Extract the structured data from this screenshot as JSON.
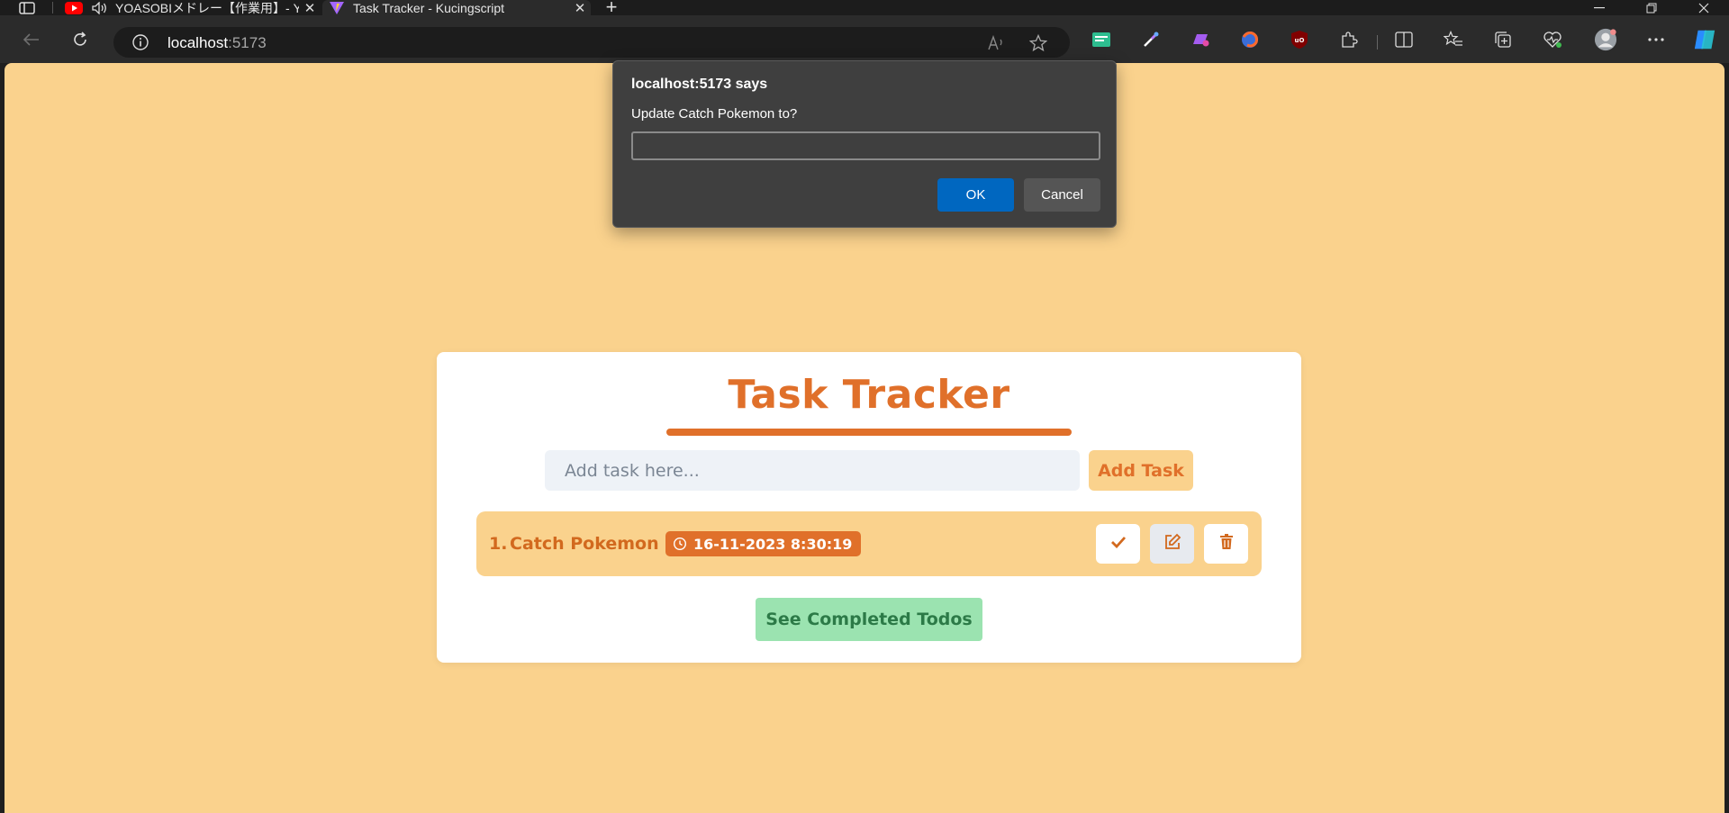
{
  "browser": {
    "tabs": [
      {
        "label": "YOASOBIメドレー【作業用】- YouTube",
        "favicon": "youtube-icon",
        "audio": "speaker-icon"
      },
      {
        "label": "Task Tracker - Kucingscript",
        "favicon": "vite-icon",
        "active": true
      }
    ],
    "address": {
      "host": "localhost",
      "port": ":5173"
    }
  },
  "app": {
    "title": "Task Tracker",
    "input": {
      "placeholder": "Add task here...",
      "value": ""
    },
    "add_button": "Add Task",
    "tasks": [
      {
        "number": "1.",
        "text": "Catch Pokemon",
        "timestamp": "16-11-2023 8:30:19"
      }
    ],
    "completed_button": "See Completed Todos"
  },
  "dialog": {
    "title": "localhost:5173 says",
    "message": "Update Catch Pokemon to?",
    "value": "",
    "ok": "OK",
    "cancel": "Cancel"
  },
  "colors": {
    "page_bg": "#fad28d",
    "accent": "#e0702a",
    "success_bg": "#9be3b0",
    "dialog_ok": "#0067c0"
  }
}
